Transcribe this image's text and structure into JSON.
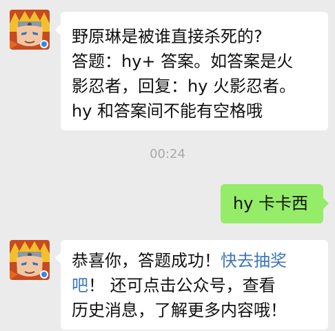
{
  "chat": {
    "messages": [
      {
        "sender": "official-account",
        "lines": [
          "野原琳是被谁直接杀死的?",
          "答题：hy+ 答案。如答案是火",
          "影忍者，回复：hy 火影忍者。",
          "hy 和答案间不能有空格哦"
        ]
      },
      {
        "timestamp": "00:24"
      },
      {
        "sender": "me",
        "text": "hy 卡卡西"
      },
      {
        "sender": "official-account",
        "line1_prefix": "恭喜你，答题成功！",
        "line1_link": "快去抽奖",
        "line2_link": "吧",
        "line2_rest": "！ 还可点击公众号，查看",
        "line3": "历史消息，了解更多内容哦！"
      }
    ]
  },
  "colors": {
    "background": "#ebebeb",
    "incoming_bubble": "#ffffff",
    "outgoing_bubble": "#95ec69",
    "link": "#3e76b8",
    "timestamp": "#a9a9a9"
  },
  "icons": {
    "avatar": "naruto-game-avatar-icon"
  }
}
